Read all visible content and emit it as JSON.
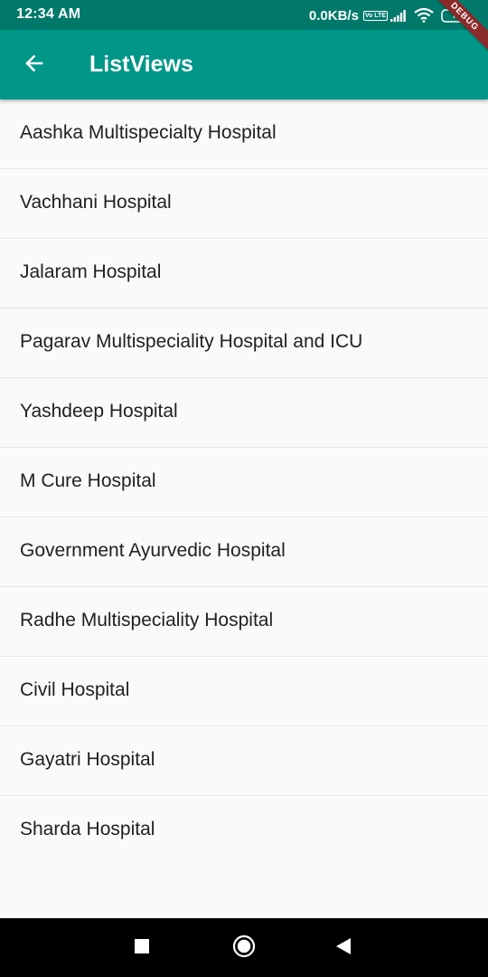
{
  "status_bar": {
    "time": "12:34 AM",
    "net_speed": "0.0KB/s",
    "volte": "Vo LTE",
    "battery": "7",
    "icons": [
      "volte-icon",
      "signal-icon",
      "wifi-icon",
      "battery-icon"
    ]
  },
  "debug_banner": "DEBUG",
  "app_bar": {
    "title": "ListViews",
    "back_icon": "arrow-back-icon",
    "color": "#009688",
    "status_color": "#00796b"
  },
  "hospitals": [
    {
      "name": "Aashka Multispecialty Hospital"
    },
    {
      "name": "Vachhani Hospital"
    },
    {
      "name": "Jalaram Hospital"
    },
    {
      "name": "Pagarav Multispeciality Hospital and ICU"
    },
    {
      "name": "Yashdeep Hospital"
    },
    {
      "name": "M Cure Hospital"
    },
    {
      "name": "Government Ayurvedic Hospital"
    },
    {
      "name": "Radhe Multispeciality Hospital"
    },
    {
      "name": "Civil Hospital"
    },
    {
      "name": "Gayatri Hospital"
    },
    {
      "name": "Sharda Hospital"
    }
  ],
  "nav_bar": {
    "icons": [
      "recents-square-icon",
      "home-circle-icon",
      "back-triangle-icon"
    ]
  }
}
